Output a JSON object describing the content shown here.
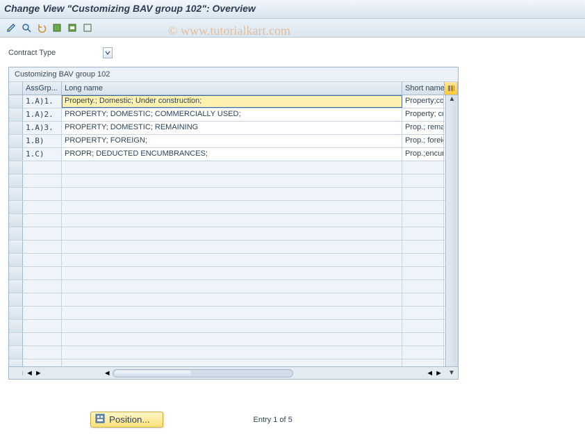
{
  "title": "Change View \"Customizing BAV group 102\": Overview",
  "watermark": "© www.tutorialkart.com",
  "toolbar": {
    "icons": [
      "toggle-display-change",
      "find",
      "undo",
      "select-all",
      "select-block",
      "deselect-all"
    ]
  },
  "field": {
    "label": "Contract Type"
  },
  "panel": {
    "title": "Customizing BAV group 102",
    "columns": {
      "ass": "AssGrp...",
      "long": "Long name",
      "short": "Short name"
    },
    "rows": [
      {
        "ass": "1.A)1.",
        "long": "Property.; Domestic; Under construction;",
        "short": "Property;con",
        "active": true
      },
      {
        "ass": "1.A)2.",
        "long": "PROPERTY; DOMESTIC; COMMERCIALLY USED;",
        "short": "Property; co"
      },
      {
        "ass": "1.A)3.",
        "long": "PROPERTY; DOMESTIC; REMAINING",
        "short": "Prop.; remain"
      },
      {
        "ass": "1.B)",
        "long": "PROPERTY; FOREIGN;",
        "short": "Prop.; foreig"
      },
      {
        "ass": "1.C)",
        "long": "PROPR; DEDUCTED ENCUMBRANCES;",
        "short": "Prop.;encum"
      }
    ],
    "empty_rows": 16
  },
  "footer": {
    "position_label": "Position...",
    "entry_info": "Entry 1 of 5"
  }
}
